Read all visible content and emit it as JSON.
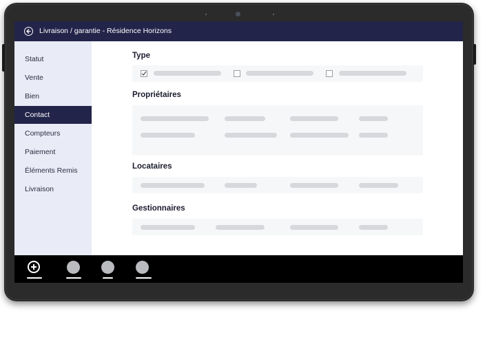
{
  "header": {
    "title": "Livraison / garantie - Résidence Horizons"
  },
  "sidebar": {
    "items": [
      {
        "label": "Statut"
      },
      {
        "label": "Vente"
      },
      {
        "label": "Bien"
      },
      {
        "label": "Contact",
        "active": true
      },
      {
        "label": "Compteurs"
      },
      {
        "label": "Paiement"
      },
      {
        "label": "Éléments Remis"
      },
      {
        "label": "Livraison"
      }
    ]
  },
  "main": {
    "sections": {
      "type": {
        "title": "Type",
        "options": [
          {
            "checked": true
          },
          {
            "checked": false
          },
          {
            "checked": false
          }
        ]
      },
      "proprietaires": {
        "title": "Propriétaires"
      },
      "locataires": {
        "title": "Locataires"
      },
      "gestionnaires": {
        "title": "Gestionnaires"
      }
    }
  },
  "bottombar": {
    "icons": [
      "plus-circle-icon",
      "avatar-icon",
      "avatar-icon",
      "avatar-icon"
    ]
  },
  "colors": {
    "header_bg": "#23244a",
    "sidebar_bg": "#e9ebf6",
    "active_bg": "#23244a",
    "placeholder": "#d6d8dc"
  }
}
